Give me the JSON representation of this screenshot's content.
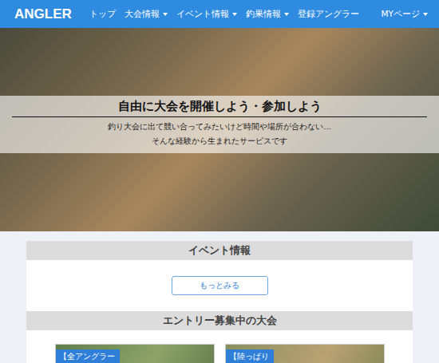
{
  "navbar": {
    "logo": "ANGLER",
    "items": [
      {
        "label": "トップ",
        "dropdown": false
      },
      {
        "label": "大会情報",
        "dropdown": true
      },
      {
        "label": "イベント情報",
        "dropdown": true
      },
      {
        "label": "釣果情報",
        "dropdown": true
      },
      {
        "label": "登録アングラー",
        "dropdown": false
      }
    ],
    "right": {
      "label": "MYページ",
      "dropdown": true
    }
  },
  "hero": {
    "title": "自由に大会を開催しよう・参加しよう",
    "lines": [
      "釣り大会に出て競い合ってみたいけど時間や場所が合わない…",
      "そんな経験から生まれたサービスです"
    ]
  },
  "events": {
    "title": "イベント情報",
    "button": "もっとみる"
  },
  "tournaments": {
    "title": "エントリー募集中の大会",
    "cards": [
      {
        "tag": "【全アングラー"
      },
      {
        "tag": "【陸っぱり"
      }
    ]
  }
}
